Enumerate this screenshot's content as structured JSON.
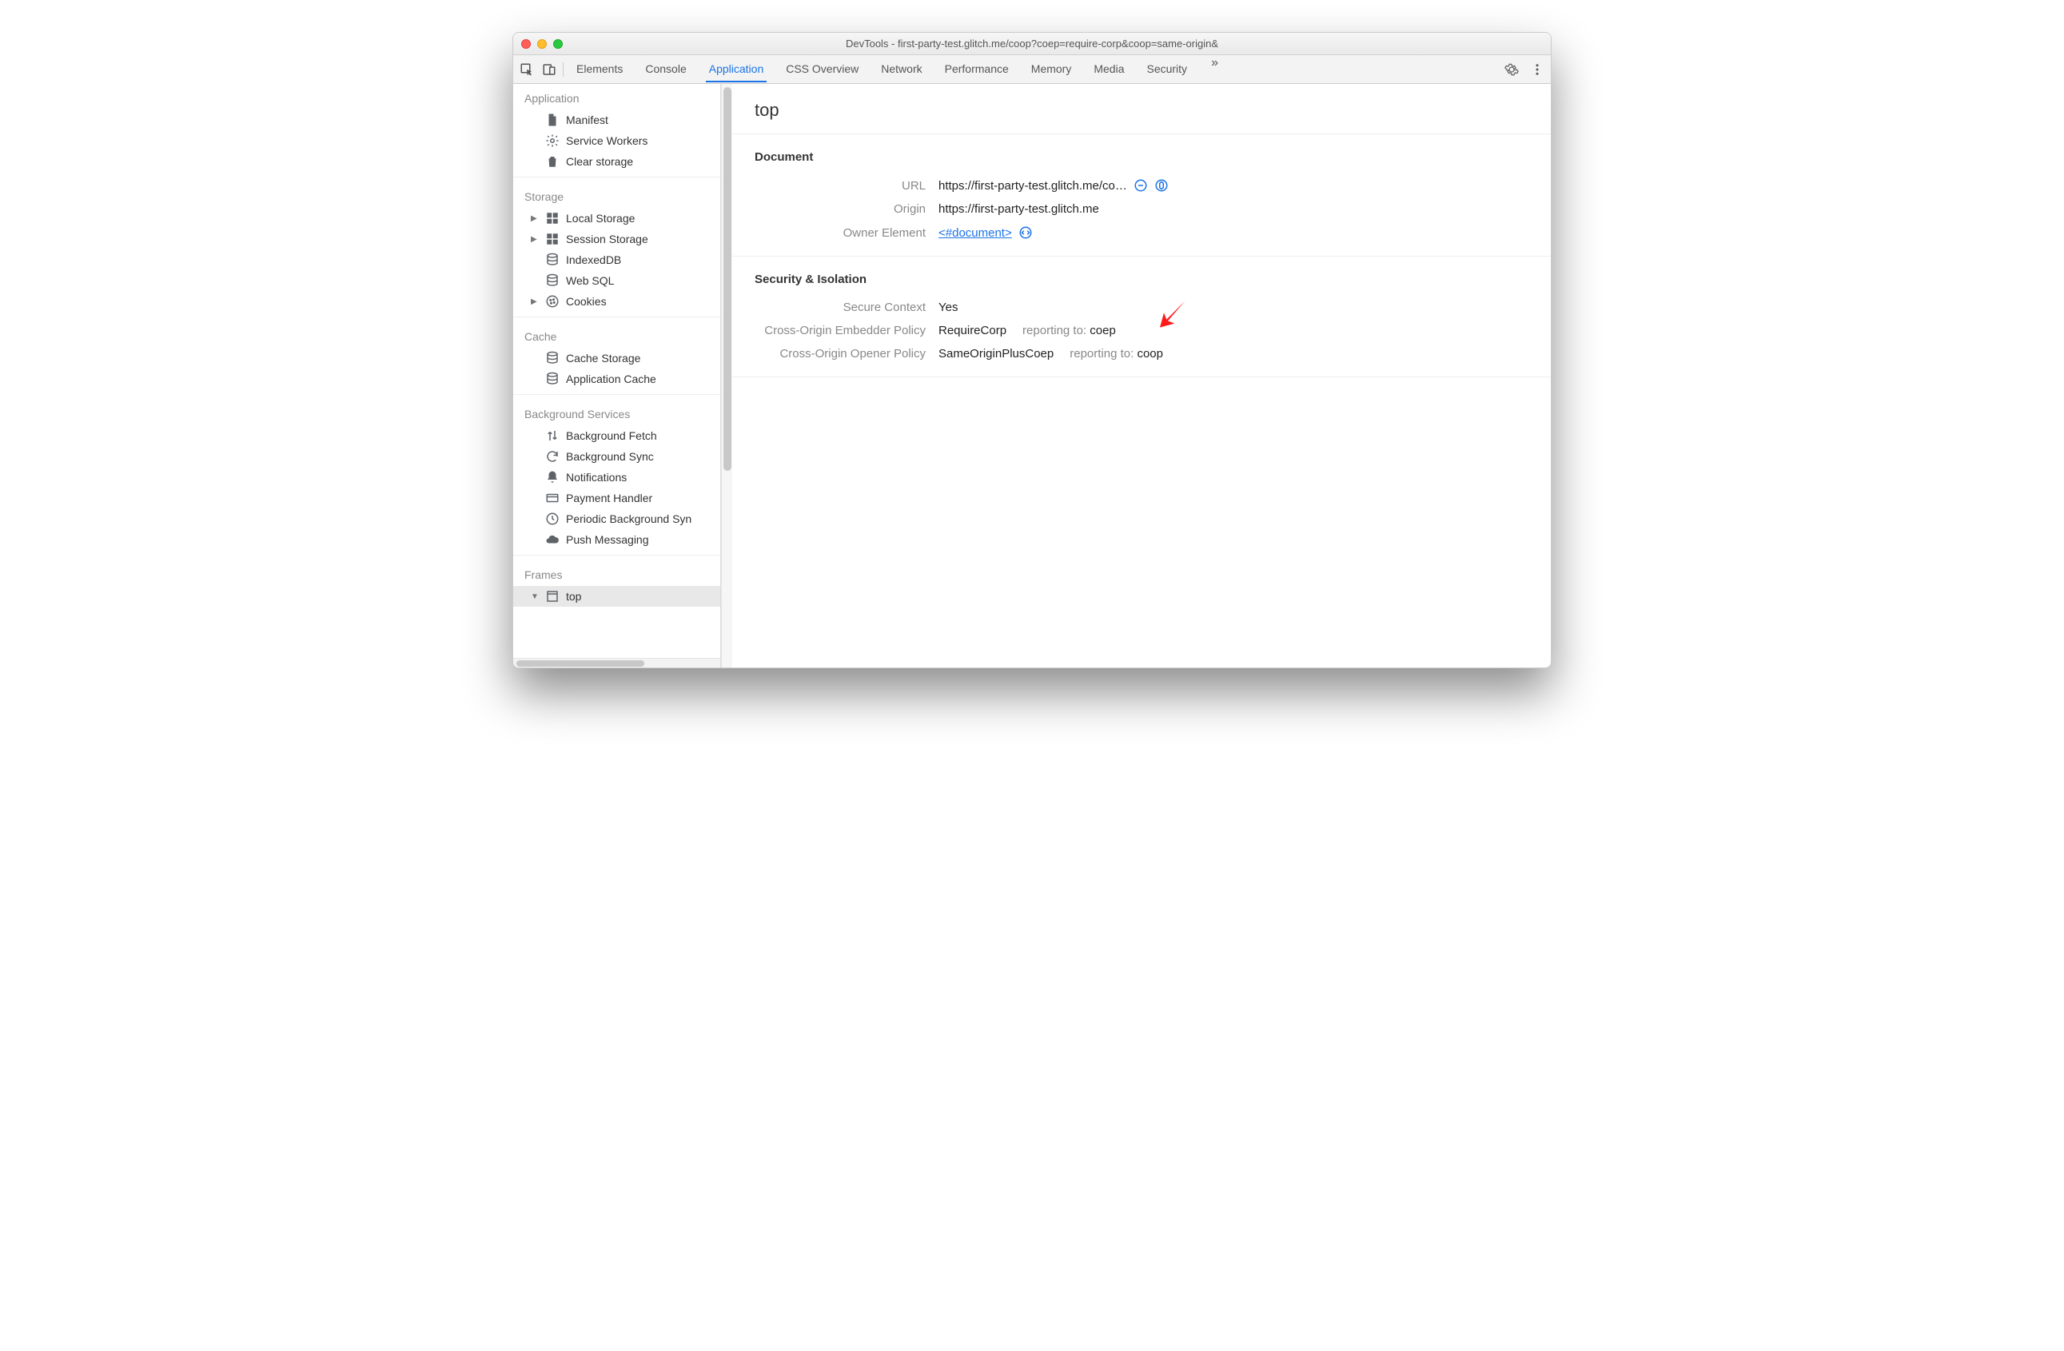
{
  "window_title": "DevTools - first-party-test.glitch.me/coop?coep=require-corp&coop=same-origin&",
  "tabs": [
    "Elements",
    "Console",
    "Application",
    "CSS Overview",
    "Network",
    "Performance",
    "Memory",
    "Media",
    "Security"
  ],
  "active_tab_index": 2,
  "sidebar": {
    "groups": [
      {
        "title": "Application",
        "items": [
          {
            "icon": "file",
            "label": "Manifest"
          },
          {
            "icon": "gear",
            "label": "Service Workers"
          },
          {
            "icon": "trash",
            "label": "Clear storage"
          }
        ]
      },
      {
        "title": "Storage",
        "items": [
          {
            "arrow": true,
            "icon": "grid",
            "label": "Local Storage"
          },
          {
            "arrow": true,
            "icon": "grid",
            "label": "Session Storage"
          },
          {
            "icon": "db",
            "label": "IndexedDB"
          },
          {
            "icon": "db",
            "label": "Web SQL"
          },
          {
            "arrow": true,
            "icon": "cookie",
            "label": "Cookies"
          }
        ]
      },
      {
        "title": "Cache",
        "items": [
          {
            "icon": "db",
            "label": "Cache Storage"
          },
          {
            "icon": "db",
            "label": "Application Cache"
          }
        ]
      },
      {
        "title": "Background Services",
        "items": [
          {
            "icon": "updn",
            "label": "Background Fetch"
          },
          {
            "icon": "sync",
            "label": "Background Sync"
          },
          {
            "icon": "bell",
            "label": "Notifications"
          },
          {
            "icon": "card",
            "label": "Payment Handler"
          },
          {
            "icon": "clock",
            "label": "Periodic Background Syn"
          },
          {
            "icon": "cloud",
            "label": "Push Messaging"
          }
        ]
      },
      {
        "title": "Frames",
        "items": [
          {
            "arrow_open": true,
            "icon": "frame",
            "label": "top",
            "selected": true
          }
        ]
      }
    ]
  },
  "main": {
    "header": "top",
    "document": {
      "section_title": "Document",
      "url_label": "URL",
      "url_value": "https://first-party-test.glitch.me/co…",
      "origin_label": "Origin",
      "origin_value": "https://first-party-test.glitch.me",
      "owner_label": "Owner Element",
      "owner_link": "<#document>"
    },
    "security": {
      "section_title": "Security & Isolation",
      "secure_label": "Secure Context",
      "secure_value": "Yes",
      "coep_label": "Cross-Origin Embedder Policy",
      "coep_value": "RequireCorp",
      "coep_reporting_prefix": "reporting to:",
      "coep_reporting_target": "coep",
      "coop_label": "Cross-Origin Opener Policy",
      "coop_value": "SameOriginPlusCoep",
      "coop_reporting_prefix": "reporting to:",
      "coop_reporting_target": "coop"
    }
  }
}
